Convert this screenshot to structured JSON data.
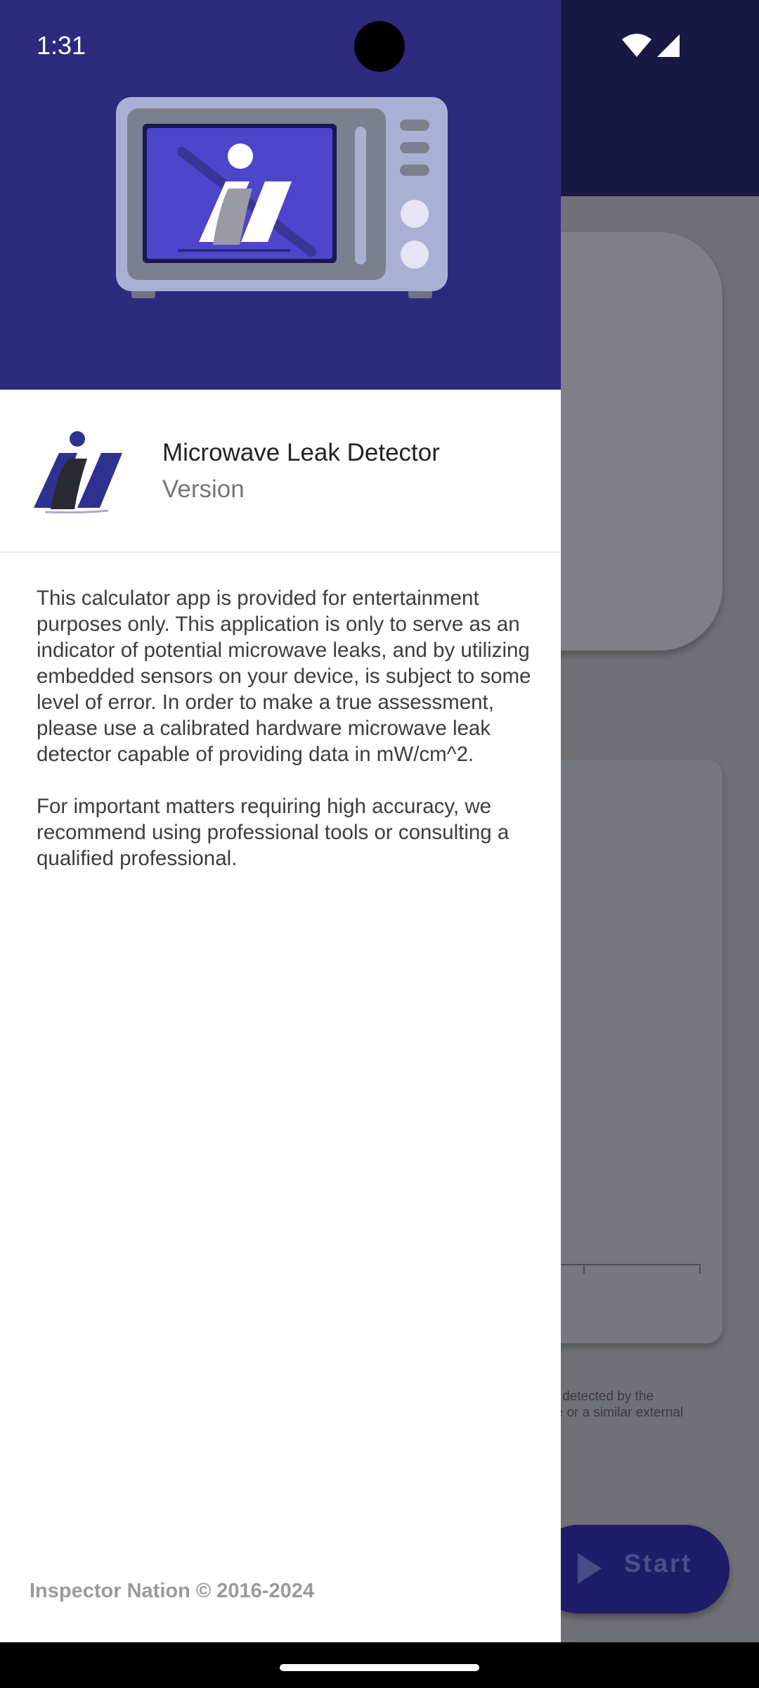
{
  "status_bar": {
    "time": "1:31"
  },
  "drawer": {
    "app_name": "Microwave Leak Detector",
    "version_label": "Version",
    "description_paragraphs": [
      "This calculator app is provided for entertainment purposes only. This application is only to serve as an indicator of potential microwave leaks, and by utilizing embedded sensors on your device, is subject to some level of error.  In order to make a true assessment, please use a calibrated hardware microwave leak detector capable of providing data in mW/cm^2.",
      "For important matters requiring high accuracy, we recommend using professional tools or consulting a qualified professional."
    ],
    "copyright": "Inspector Nation © 2016-2024"
  },
  "background_app": {
    "note_text": "field detected by the\nkage or a similar external",
    "start_button_label": "Start"
  },
  "colors": {
    "drawer_header": "#2d2a7e",
    "top_bar": "#191843",
    "logo_blue": "#2e318f",
    "start_button": "#1f1d68"
  },
  "icons": [
    "wifi-icon",
    "signal-icon",
    "microwave-illustration",
    "app-logo-icon",
    "play-icon"
  ]
}
